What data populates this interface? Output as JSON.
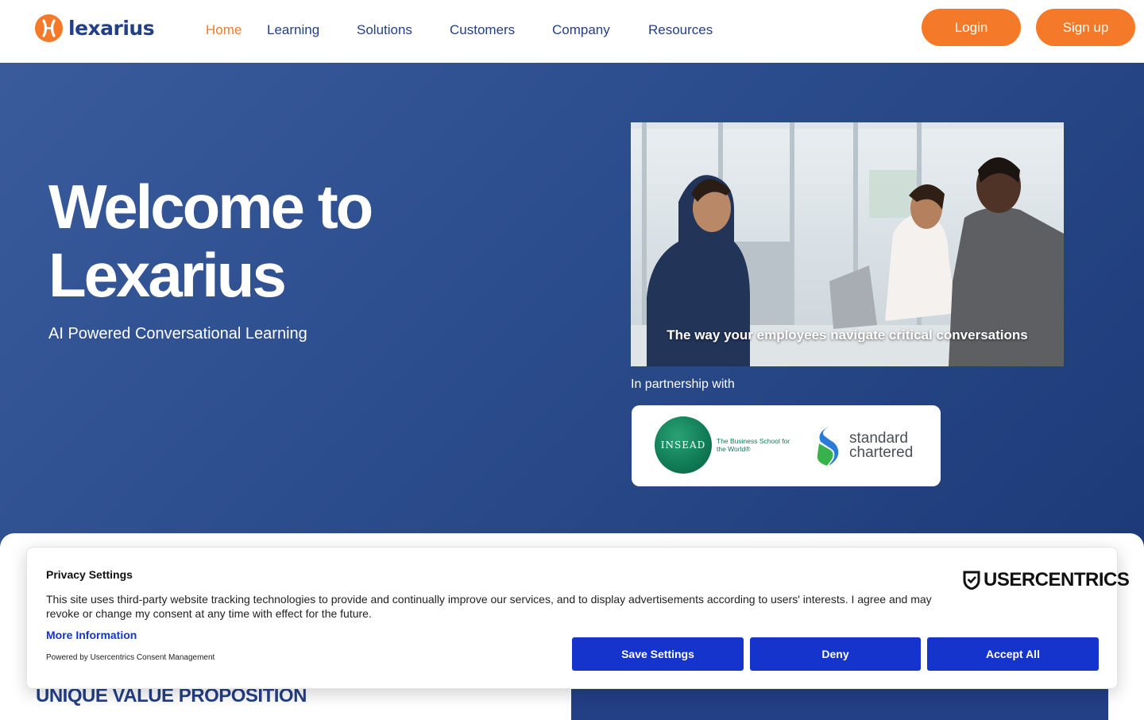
{
  "brand": {
    "name": "lexarius",
    "accent": "#f47a2a",
    "primary": "#233f86",
    "logo_icon": "lexarius-logo-icon"
  },
  "nav": {
    "items": [
      {
        "label": "Home",
        "active": true
      },
      {
        "label": "Learning",
        "active": false
      },
      {
        "label": "Solutions",
        "active": false
      },
      {
        "label": "Customers",
        "active": false
      },
      {
        "label": "Company",
        "active": false
      },
      {
        "label": "Resources",
        "active": false
      }
    ]
  },
  "auth": {
    "login_label": "Login",
    "signup_label": "Sign up"
  },
  "hero": {
    "title_line1": "Welcome to",
    "title_line2": "Lexarius",
    "subtitle": "AI Powered Conversational Learning",
    "video_caption": "The way your employees navigate critical conversations",
    "partner_label": "In partnership with",
    "partners": {
      "insead_name": "INSEAD",
      "insead_tagline": "The Business School for the World®",
      "sc_line1": "standard",
      "sc_line2": "chartered"
    }
  },
  "section": {
    "heading": "UNIQUE VALUE PROPOSITION"
  },
  "consent": {
    "title": "Privacy Settings",
    "body": "This site uses third-party website tracking technologies to provide and continually improve our services, and to display advertisements according to users' interests. I agree and may revoke or change my consent at any time with effect for the future.",
    "more_info_label": "More Information",
    "powered_by": "Powered by Usercentrics Consent Management",
    "brand": "USERCENTRICS",
    "buttons": {
      "save": "Save Settings",
      "deny": "Deny",
      "accept": "Accept All"
    },
    "button_color": "#1434cb"
  }
}
